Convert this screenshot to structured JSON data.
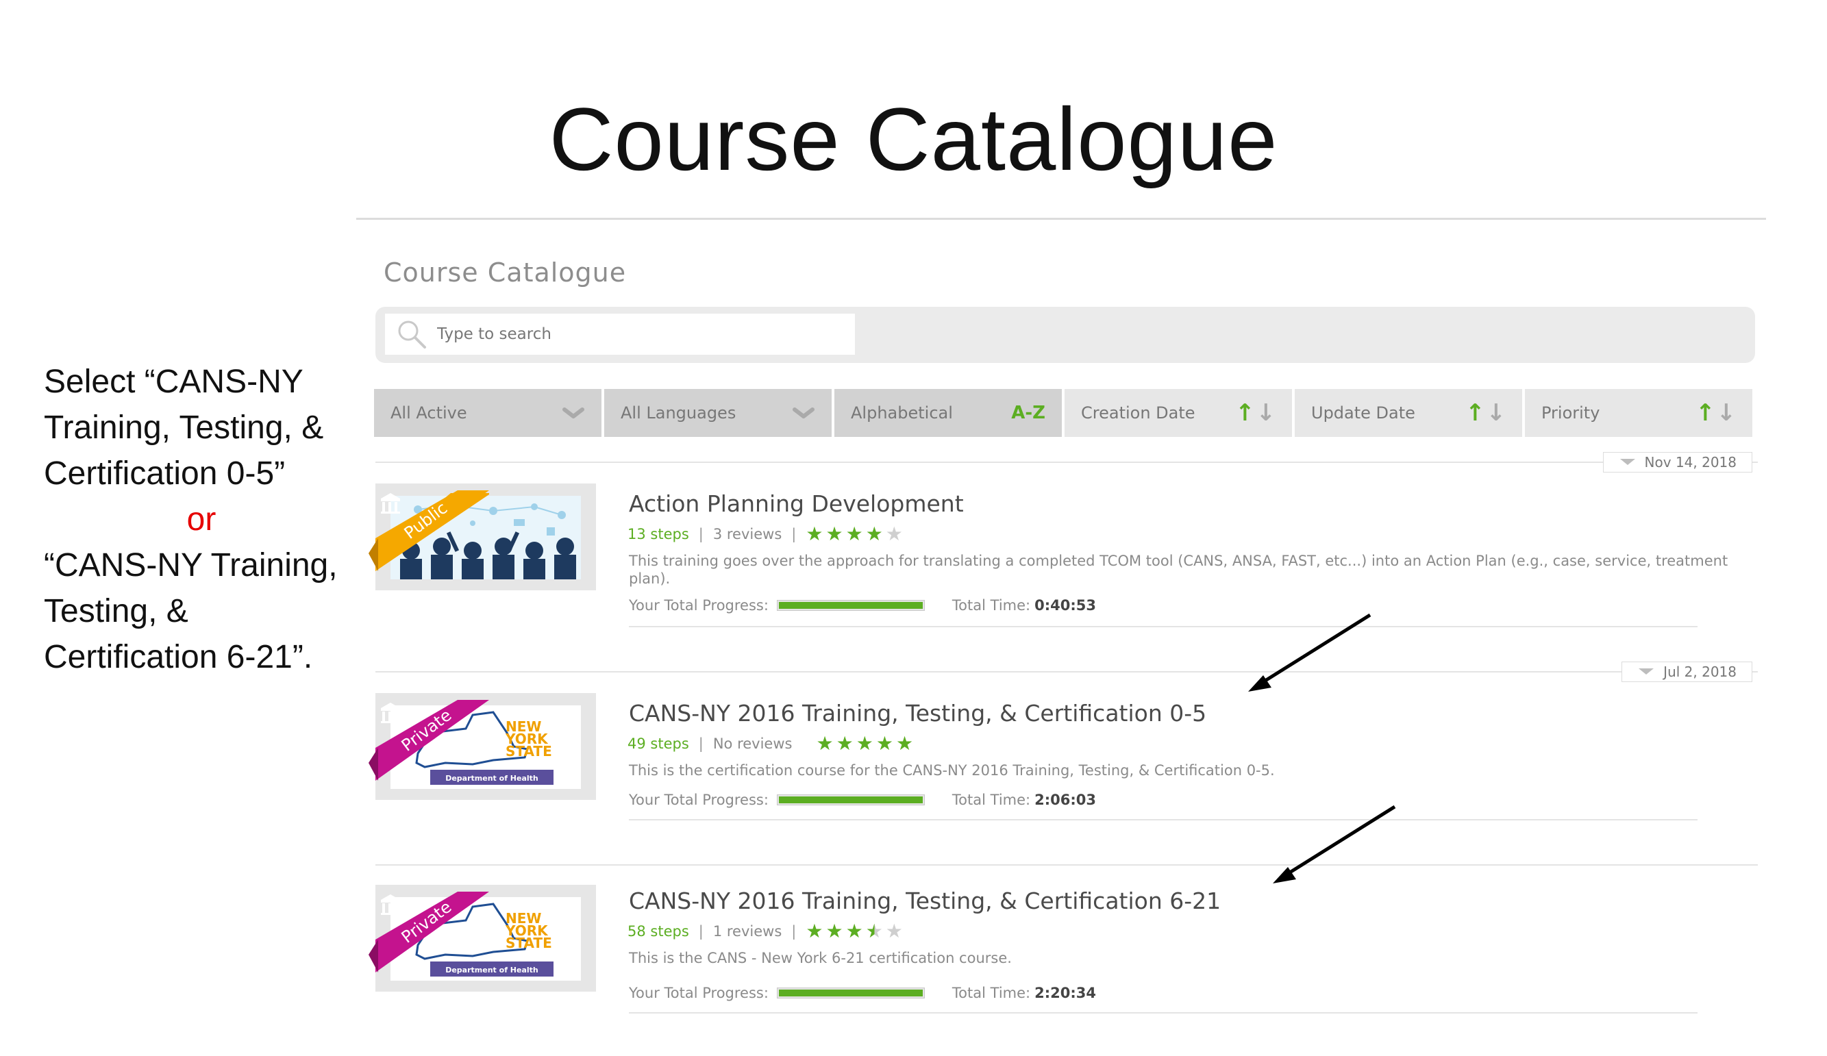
{
  "slide": {
    "title": "Course Catalogue",
    "instructions": {
      "line1": "Select “CANS-NY Training, Testing, & Certification 0-5”",
      "or": "or",
      "line2": "“CANS-NY Training, Testing, & Certification 6-21”."
    }
  },
  "catalogue": {
    "title": "Course Catalogue",
    "search": {
      "placeholder": "Type to search",
      "value": ""
    },
    "filters": [
      {
        "label": "All Active",
        "icon": "chevron-down-icon"
      },
      {
        "label": "All Languages",
        "icon": "chevron-down-icon"
      },
      {
        "label": "Alphabetical",
        "indicator": "A-Z"
      },
      {
        "label": "Creation Date",
        "icon": "sort-arrows-icon"
      },
      {
        "label": "Update Date",
        "icon": "sort-arrows-icon"
      },
      {
        "label": "Priority",
        "icon": "sort-arrows-icon"
      }
    ]
  },
  "courses": [
    {
      "date": "Nov 14, 2018",
      "visibility": "Public",
      "title": "Action Planning Development",
      "steps": "13 steps",
      "reviews": "3 reviews",
      "rating": 4,
      "description": "This training goes over the approach for translating a completed TCOM tool (CANS, ANSA, FAST, etc...) into an Action Plan (e.g., case, service, treatment plan).",
      "progress_label": "Your Total Progress:",
      "progress": 1.0,
      "time_label": "Total Time:",
      "time": "0:40:53"
    },
    {
      "date": "Jul 2, 2018",
      "visibility": "Private",
      "title": "CANS-NY 2016 Training, Testing, & Certification 0-5",
      "steps": "49 steps",
      "reviews": "No reviews",
      "rating": 5,
      "description": "This is the certification course for the CANS-NY 2016 Training, Testing, & Certification 0-5.",
      "progress_label": "Your Total Progress:",
      "progress": 1.0,
      "time_label": "Total Time:",
      "time": "2:06:03",
      "logo": {
        "line1": "NEW",
        "line2": "YORK",
        "line3": "STATE",
        "dept": "Department of Health"
      }
    },
    {
      "visibility": "Private",
      "title": "CANS-NY 2016 Training, Testing, & Certification 6-21",
      "steps": "58 steps",
      "reviews": "1 reviews",
      "rating": 3.5,
      "description": "This is the CANS - New York 6-21 certification course.",
      "progress_label": "Your Total Progress:",
      "progress": 1.0,
      "time_label": "Total Time:",
      "time": "2:20:34",
      "logo": {
        "line1": "NEW",
        "line2": "YORK",
        "line3": "STATE",
        "dept": "Department of Health"
      }
    }
  ],
  "colors": {
    "accent_green": "#5cae22",
    "public_ribbon": "#f5a800",
    "private_ribbon": "#c4138e",
    "annotation_red": "#e60000"
  }
}
